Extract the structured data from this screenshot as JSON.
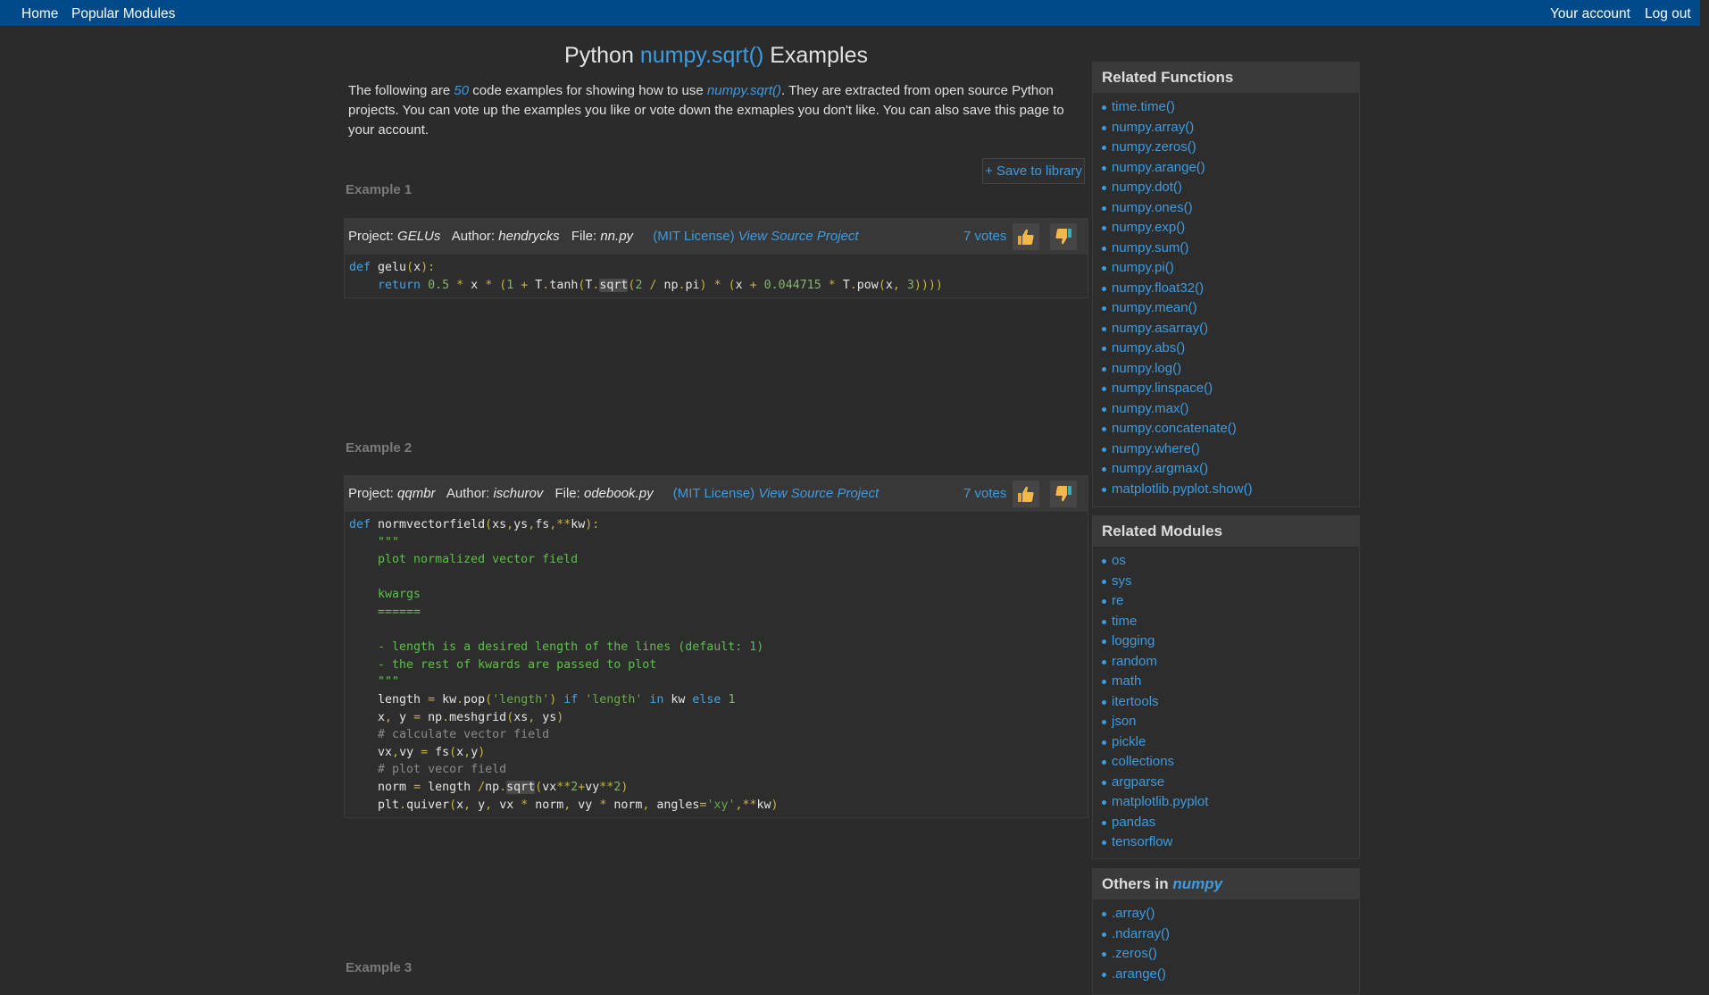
{
  "nav": {
    "home": "Home",
    "popular": "Popular Modules",
    "account": "Your account",
    "logout": "Log out"
  },
  "title": {
    "prefix": "Python",
    "fn": "numpy.sqrt()",
    "suffix": "Examples"
  },
  "intro": {
    "part1": "The following are ",
    "count": "50",
    "part2": " code examples for showing how to use ",
    "fn": "numpy.sqrt()",
    "part3": ". They are extracted from open source Python projects. You can vote up the examples you like or vote down the exmaples you don't like. You can also save this page to your account."
  },
  "save_label": "+ Save to library",
  "examples": [
    {
      "heading": "Example 1",
      "project": "GELUs",
      "author": "hendrycks",
      "file": "nn.py",
      "license": "(MIT License)",
      "source": "View Source Project",
      "votes": "7 votes"
    },
    {
      "heading": "Example 2",
      "project": "qqmbr",
      "author": "ischurov",
      "file": "odebook.py",
      "license": "(MIT License)",
      "source": "View Source Project",
      "votes": "7 votes"
    },
    {
      "heading": "Example 3"
    }
  ],
  "labels": {
    "project": "Project:",
    "author": "Author:",
    "file": "File:"
  },
  "related_functions": {
    "title": "Related Functions",
    "items": [
      "time.time()",
      "numpy.array()",
      "numpy.zeros()",
      "numpy.arange()",
      "numpy.dot()",
      "numpy.ones()",
      "numpy.exp()",
      "numpy.sum()",
      "numpy.pi()",
      "numpy.float32()",
      "numpy.mean()",
      "numpy.asarray()",
      "numpy.abs()",
      "numpy.log()",
      "numpy.linspace()",
      "numpy.max()",
      "numpy.concatenate()",
      "numpy.where()",
      "numpy.argmax()",
      "matplotlib.pyplot.show()"
    ]
  },
  "related_modules": {
    "title": "Related Modules",
    "items": [
      "os",
      "sys",
      "re",
      "time",
      "logging",
      "random",
      "math",
      "itertools",
      "json",
      "pickle",
      "collections",
      "argparse",
      "matplotlib.pyplot",
      "pandas",
      "tensorflow"
    ]
  },
  "others": {
    "title_prefix": "Others in ",
    "module": "numpy",
    "items": [
      ".array()",
      ".ndarray()",
      ".zeros()",
      ".arange()"
    ]
  },
  "colors": {
    "topbar": "#004a8a",
    "link": "#3d9be0",
    "background": "#2b2b2b"
  }
}
